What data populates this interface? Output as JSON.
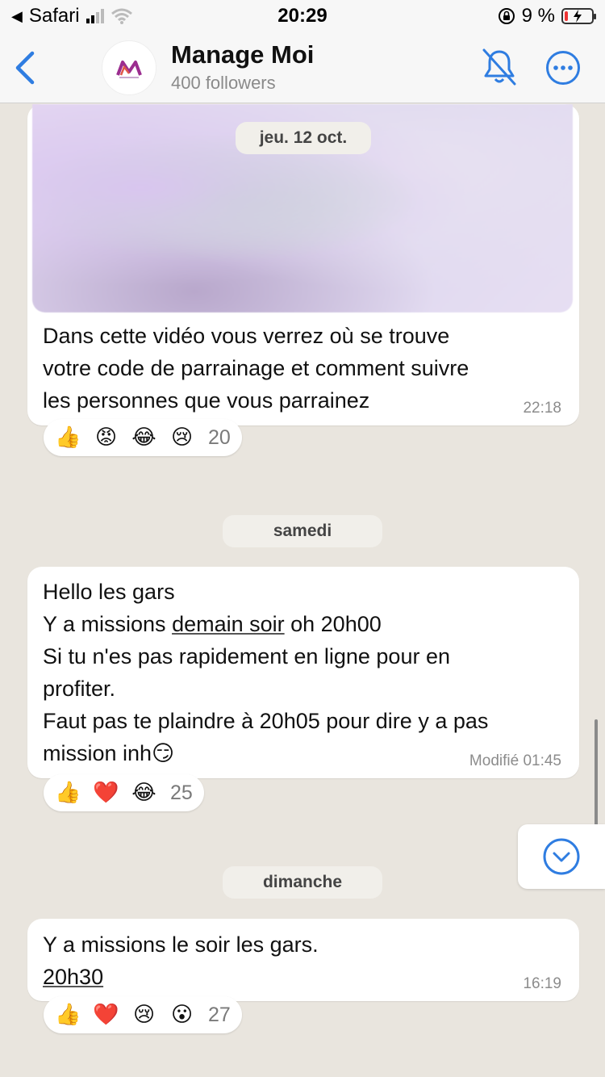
{
  "status_bar": {
    "back_app": "Safari",
    "time": "20:29",
    "battery": "9 %"
  },
  "header": {
    "title": "Manage Moi",
    "subtitle": "400 followers",
    "avatar_icon": "manage-moi-logo",
    "mute_icon": "bell-slash-icon",
    "more_icon": "ellipsis-circle-icon"
  },
  "messages": [
    {
      "date_pill": "jeu. 12 oct.",
      "has_media": true,
      "lines": [
        "Dans cette vidéo vous verrez où se trouve",
        "votre code de parrainage et comment suivre",
        "les personnes que vous parrainez"
      ],
      "time": "22:18",
      "reactions": {
        "emojis": [
          "👍",
          "😡",
          "😂",
          "😢"
        ],
        "count": "20"
      }
    },
    {
      "date_pill": "samedi",
      "line1": "Hello les gars",
      "line2_pre": "Y a missions ",
      "line2_link": "demain soir",
      "line2_post": " oh 20h00",
      "line3": "Si tu n'es pas rapidement en ligne pour en",
      "line4": "profiter.",
      "line5": "Faut pas te plaindre à 20h05 pour dire y a pas",
      "line6": "mission inh😏",
      "time": "Modifié 01:45",
      "reactions": {
        "emojis": [
          "👍",
          "❤️",
          "😂"
        ],
        "count": "25"
      }
    },
    {
      "date_pill": "dimanche",
      "line1": "Y a missions le soir les gars.",
      "line2_link": "20h30",
      "time": "16:19",
      "reactions": {
        "emojis": [
          "👍",
          "❤️",
          "😢",
          "😮"
        ],
        "count": "27"
      }
    }
  ],
  "accent_color": "#2f7de1"
}
